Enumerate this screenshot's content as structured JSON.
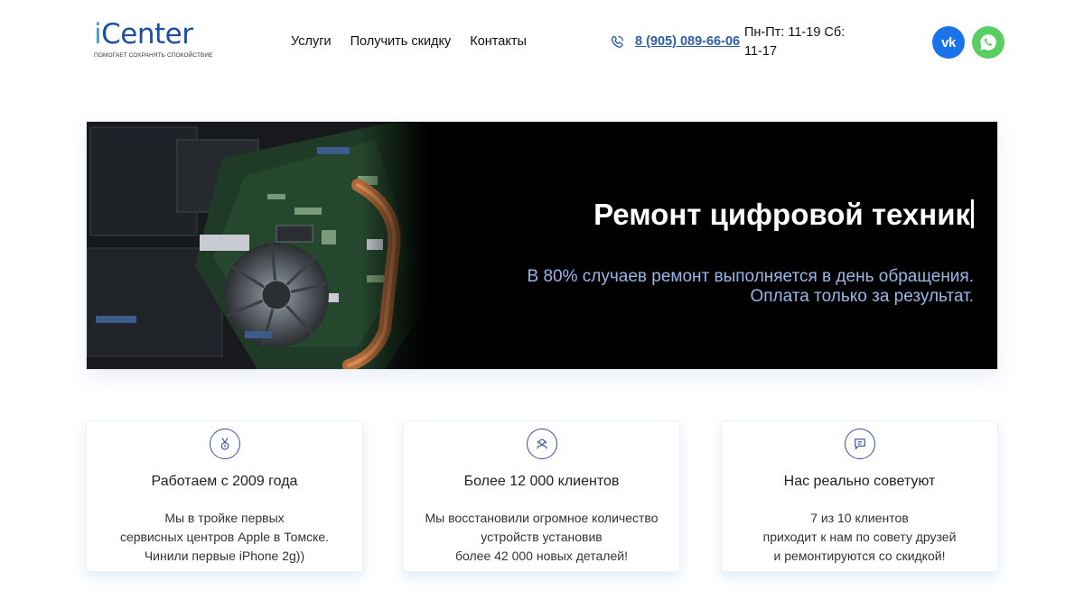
{
  "header": {
    "logo_text_first": "i",
    "logo_text_rest": "Center",
    "logo_tagline": "ПОМОГАЕТ СОХРАНЯТЬ СПОКОЙСТВИЕ",
    "nav": [
      {
        "label": "Услуги"
      },
      {
        "label": "Получить скидку"
      },
      {
        "label": "Контакты"
      }
    ],
    "phone": "8 (905) 089-66-06",
    "hours": "Пн-Пт: 11-19 Сб: 11-17",
    "social": {
      "vk_label": "vk",
      "vk_icon": "vk-icon",
      "whatsapp_icon": "whatsapp-icon"
    }
  },
  "hero": {
    "title": "Ремонт цифровой техник",
    "subtitle_line1": "В 80% случаев ремонт выполняется в день обращения.",
    "subtitle_line2": "Оплата только за результат.",
    "image": "laptop-motherboard-photo"
  },
  "features": [
    {
      "icon": "medal-icon",
      "title": "Работаем с 2009 года",
      "lines": [
        "Мы в тройке первых",
        "сервисных центров Apple в Томске.",
        "Чинили первые iPhone 2g))"
      ]
    },
    {
      "icon": "users-icon",
      "title": "Более 12 000 клиентов",
      "lines": [
        "Мы восстановили огромное количество",
        "устройств установив",
        "более 42 000 новых деталей!"
      ]
    },
    {
      "icon": "chat-icon",
      "title": "Нас реально советуют",
      "lines": [
        "7 из 10 клиентов",
        "приходит к нам по совету друзей",
        "и ремонтируются со скидкой!"
      ]
    }
  ],
  "colors": {
    "brand": "#1f4fa0",
    "brand_accent": "#2fa3d8",
    "phone_link": "#2d5fa6",
    "vk": "#1a73e8",
    "whatsapp": "#5bce63",
    "hero_subtitle": "#9ab5e8",
    "hero_background": "#000000"
  }
}
